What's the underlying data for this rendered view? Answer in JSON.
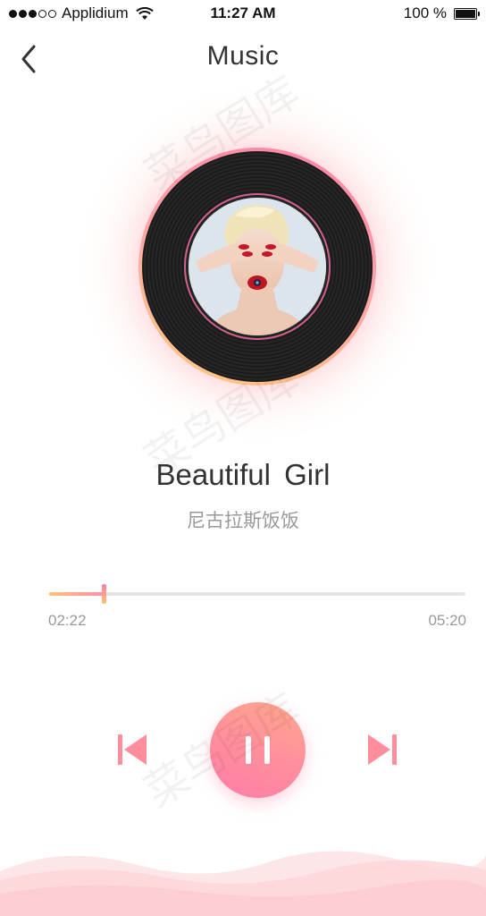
{
  "status_bar": {
    "carrier": "Applidium",
    "time": "11:27 AM",
    "battery": "100 %"
  },
  "nav": {
    "title": "Music",
    "back_icon": "chevron-left-icon"
  },
  "song": {
    "title": "Beautiful  Girl",
    "artist": "尼古拉斯饭饭"
  },
  "progress": {
    "current": "02:22",
    "total": "05:20",
    "fraction": 0.13
  },
  "controls": {
    "prev_icon": "skip-previous-icon",
    "pause_icon": "pause-icon",
    "next_icon": "skip-next-icon"
  },
  "watermark": "菜鸟图库",
  "colors": {
    "accent_pink": "#ff8fa8",
    "accent_orange": "#ffc27a"
  }
}
